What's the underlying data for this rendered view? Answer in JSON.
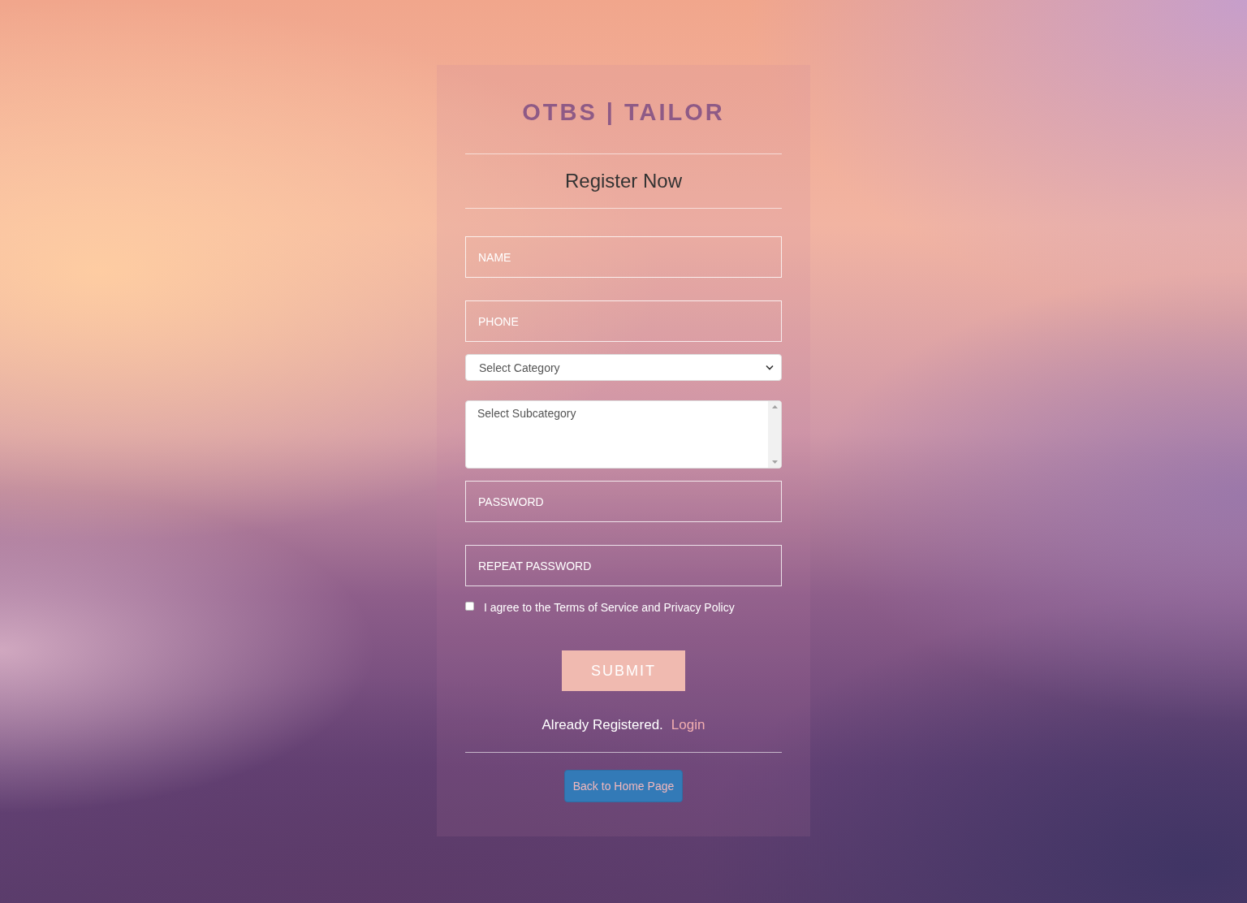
{
  "brand": {
    "title": "OTBS | TAILOR"
  },
  "heading": "Register Now",
  "fields": [
    {
      "kind": "text",
      "placeholder": "NAME"
    },
    {
      "kind": "text",
      "placeholder": "PHONE"
    },
    {
      "kind": "select",
      "value": "Select Category"
    },
    {
      "kind": "listbox",
      "options": [
        "Select Subcategory"
      ]
    },
    {
      "kind": "text",
      "placeholder": "PASSWORD"
    },
    {
      "kind": "text",
      "placeholder": "REPEAT PASSWORD"
    }
  ],
  "agreement": {
    "checked": false,
    "label": "I agree to the Terms of Service and Privacy Policy"
  },
  "submit": "SUBMIT",
  "login_prompt": {
    "text": "Already Registered.",
    "link": "Login"
  },
  "home_button": "Back to Home Page"
}
